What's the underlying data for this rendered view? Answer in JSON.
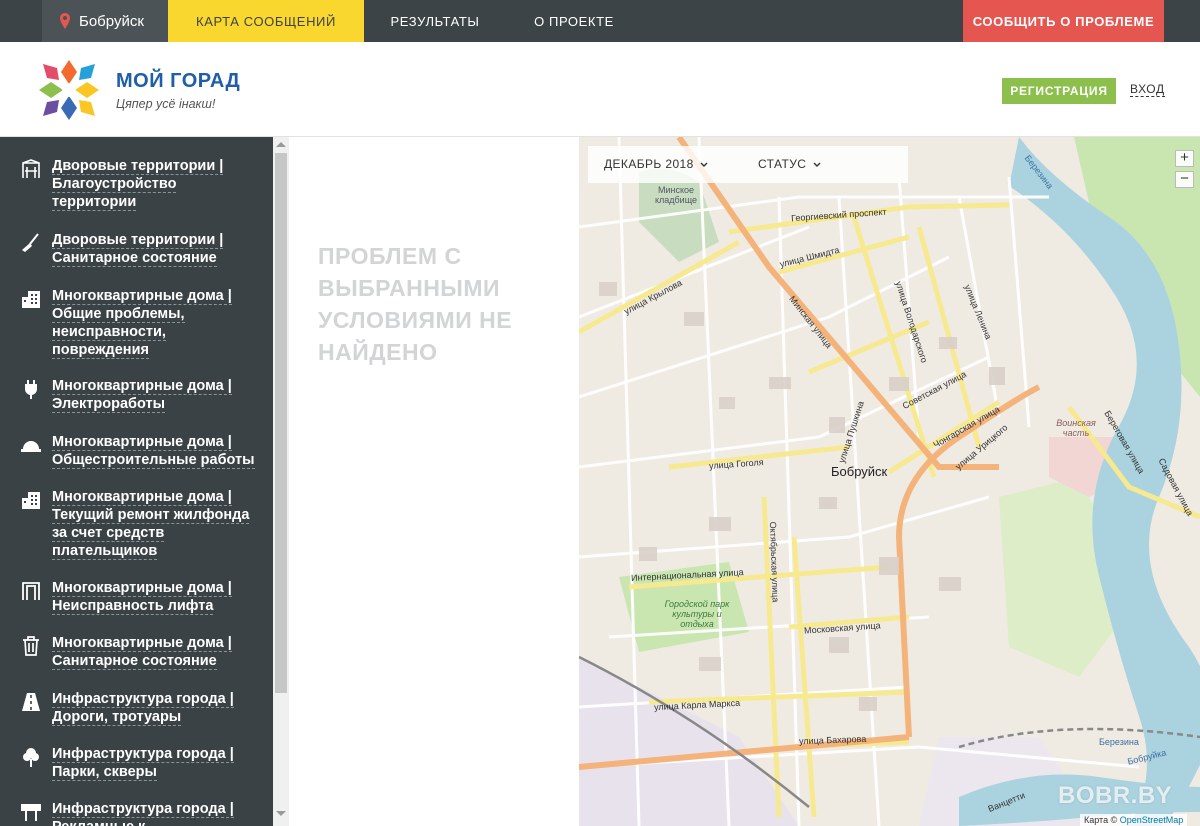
{
  "nav": {
    "city": "Бобруйск",
    "links": [
      "КАРТА СООБЩЕНИЙ",
      "РЕЗУЛЬТАТЫ",
      "О ПРОЕКТЕ"
    ],
    "report_button": "СООБЩИТЬ О ПРОБЛЕМЕ"
  },
  "header": {
    "logo_title": "МОЙ ГОРАД",
    "logo_subtitle": "Цяпер усё інакш!",
    "register": "РЕГИСТРАЦИЯ",
    "login": "ВХОД"
  },
  "categories": [
    {
      "label": "Дворовые территории | Благоустройство территории",
      "icon": "playground-icon"
    },
    {
      "label": "Дворовые территории | Санитарное состояние",
      "icon": "broom-icon"
    },
    {
      "label": "Многоквартирные дома | Общие проблемы, неисправности, повреждения",
      "icon": "apartment-building-icon"
    },
    {
      "label": "Многоквартирные дома | Электроработы",
      "icon": "plug-icon"
    },
    {
      "label": "Многоквартирные дома | Общестроительные работы",
      "icon": "hardhat-icon"
    },
    {
      "label": "Многоквартирные дома | Текущий ремонт жилфонда за счет средств плательщиков",
      "icon": "apartment-building-icon"
    },
    {
      "label": "Многоквартирные дома | Неисправность лифта",
      "icon": "elevator-icon"
    },
    {
      "label": "Многоквартирные дома | Санитарное состояние",
      "icon": "trash-icon"
    },
    {
      "label": "Инфраструктура города | Дороги, тротуары",
      "icon": "road-icon"
    },
    {
      "label": "Инфраструктура города | Парки, скверы",
      "icon": "tree-icon"
    },
    {
      "label": "Инфраструктура города | Рекламные к",
      "icon": "billboard-icon"
    }
  ],
  "empty_message": "ПРОБЛЕМ С ВЫБРАННЫМИ УСЛОВИЯМИ НЕ НАЙДЕНО",
  "map": {
    "filter_date": "ДЕКАБРЬ 2018",
    "filter_status": "СТАТУС",
    "zoom_in": "+",
    "zoom_out": "−",
    "attribution_prefix": "Карта ©",
    "attribution_link": "OpenStreetMap",
    "city_label": "Бобруйск",
    "labels": {
      "cemetery": "Минское кладбище",
      "georgievsky": "Георгиевский проспект",
      "shmidta": "улица Шмидта",
      "krylova": "улица Крылова",
      "volodarskogo": "улица Володарского",
      "lenina": "улица Ленина",
      "minskaya": "Минская улица",
      "sovetskaya": "Советская улица",
      "chongarskaya": "Чонгарская улица",
      "uritskogo": "улица Урицкого",
      "pushkina": "улица Пушкина",
      "gogolya": "улица Гоголя",
      "military": "Воинская часть",
      "beregovaya": "Береговая улица",
      "sadovaya": "Садовая улица",
      "berezina_top": "Березина",
      "internatsionalnaya": "Интернациональная улица",
      "oktyabrskaya": "Октябрьская улица",
      "park": "Городской парк культуры и отдыха",
      "moskovskaya": "Московская улица",
      "karla_marksa": "улица Карла Маркса",
      "bakharova": "улица Бахарова",
      "berezina_bottom": "Березина",
      "bobruyka": "Бобруйка",
      "vanzetti": "Ванцетти"
    }
  },
  "watermark": "BOBR.BY",
  "colors": {
    "nav_bg": "#3d4447",
    "active_tab": "#f9d72f",
    "report": "#e4564f",
    "register": "#8cbf4c",
    "sidebar_bg": "#3b4245",
    "logo_blue": "#1f5ea8"
  }
}
